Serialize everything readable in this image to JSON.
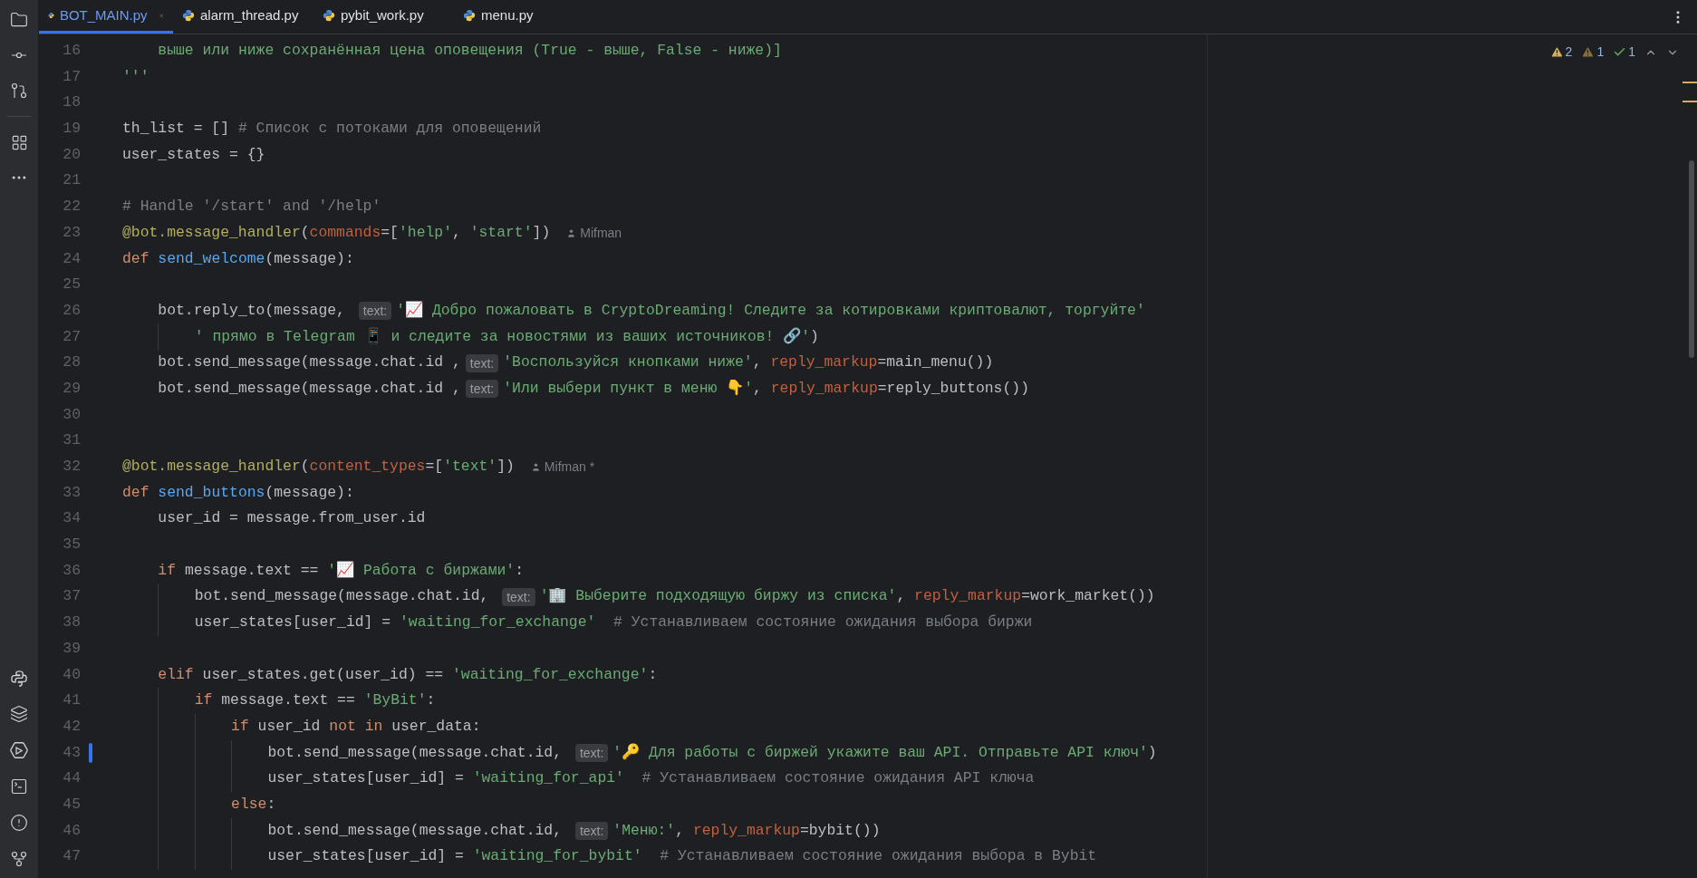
{
  "tabs": [
    {
      "label": "BOT_MAIN.py",
      "selected": true,
      "closable": true
    },
    {
      "label": "alarm_thread.py",
      "selected": false,
      "closable": false
    },
    {
      "label": "pybit_work.py",
      "selected": false,
      "closable": false
    },
    {
      "label": "menu.py",
      "selected": false,
      "closable": false
    }
  ],
  "inspections": [
    {
      "kind": "warning",
      "count": "2"
    },
    {
      "kind": "weak_warning",
      "count": "1"
    },
    {
      "kind": "typo",
      "count": "1"
    }
  ],
  "lines": [
    {
      "number": "16",
      "tokens": [
        {
          "kind": "string",
          "text": "    выше или ниже сохранённая цена оповещения (True - выше, False - ниже)]"
        }
      ]
    },
    {
      "number": "17",
      "tokens": [
        {
          "kind": "string",
          "text": "'''"
        }
      ]
    },
    {
      "number": "18"
    },
    {
      "number": "19",
      "tokens": [
        {
          "kind": "plain",
          "text": "th_list = [] "
        },
        {
          "kind": "comment",
          "text": "# Список с потоками для оповещений"
        }
      ]
    },
    {
      "number": "20",
      "tokens": [
        {
          "kind": "plain",
          "text": "user_states = {}"
        }
      ]
    },
    {
      "number": "21"
    },
    {
      "number": "22",
      "tokens": [
        {
          "kind": "comment",
          "text": "# Handle '/start' and '/help'"
        }
      ]
    },
    {
      "number": "23",
      "tokens": [
        {
          "kind": "decorator",
          "text": "@bot.message_handler"
        },
        {
          "kind": "plain",
          "text": "("
        },
        {
          "kind": "param",
          "text": "commands"
        },
        {
          "kind": "plain",
          "text": "=["
        },
        {
          "kind": "string",
          "text": "'help'"
        },
        {
          "kind": "plain",
          "text": ", "
        },
        {
          "kind": "string",
          "text": "'start'"
        },
        {
          "kind": "plain",
          "text": "])"
        },
        {
          "kind": "author",
          "text": "Mifman"
        }
      ]
    },
    {
      "number": "24",
      "tokens": [
        {
          "kind": "keyword",
          "text": "def "
        },
        {
          "kind": "function",
          "text": "send_welcome"
        },
        {
          "kind": "plain",
          "text": "(message):"
        }
      ]
    },
    {
      "number": "25"
    },
    {
      "number": "26",
      "tokens": [
        {
          "kind": "plain",
          "text": "    bot.reply_to(message, "
        },
        {
          "kind": "hint",
          "text": "text:"
        },
        {
          "kind": "string",
          "text": "'📈 Добро пожаловать в CryptoDreaming! Следите за котировками криптовалют, торгуйте'"
        }
      ]
    },
    {
      "number": "27",
      "tokens": [
        {
          "kind": "string",
          "text": "                                   ' прямо в Telegram 📱 и следите за новостями из ваших источников! 🔗'"
        },
        {
          "kind": "plain",
          "text": ")"
        }
      ]
    },
    {
      "number": "28",
      "tokens": [
        {
          "kind": "plain",
          "text": "    bot.send_message(message.chat.id ,"
        },
        {
          "kind": "hint",
          "text": "text:"
        },
        {
          "kind": "string",
          "text": "'Воспользуйся кнопками ниже'"
        },
        {
          "kind": "plain",
          "text": ", "
        },
        {
          "kind": "param",
          "text": "reply_markup"
        },
        {
          "kind": "plain",
          "text": "=main_menu())"
        }
      ]
    },
    {
      "number": "29",
      "tokens": [
        {
          "kind": "plain",
          "text": "    bot.send_message(message.chat.id ,"
        },
        {
          "kind": "hint",
          "text": "text:"
        },
        {
          "kind": "string",
          "text": "'Или выбери пункт в меню 👇'"
        },
        {
          "kind": "plain",
          "text": ", "
        },
        {
          "kind": "param",
          "text": "reply_markup"
        },
        {
          "kind": "plain",
          "text": "=reply_buttons())"
        }
      ]
    },
    {
      "number": "30"
    },
    {
      "number": "31"
    },
    {
      "number": "32",
      "tokens": [
        {
          "kind": "decorator",
          "text": "@bot.message_handler"
        },
        {
          "kind": "plain",
          "text": "("
        },
        {
          "kind": "param",
          "text": "content_types"
        },
        {
          "kind": "plain",
          "text": "=["
        },
        {
          "kind": "string",
          "text": "'text'"
        },
        {
          "kind": "plain",
          "text": "])"
        },
        {
          "kind": "author",
          "text": "Mifman *"
        }
      ]
    },
    {
      "number": "33",
      "tokens": [
        {
          "kind": "keyword",
          "text": "def "
        },
        {
          "kind": "function",
          "text": "send_buttons"
        },
        {
          "kind": "plain",
          "text": "(message):"
        }
      ]
    },
    {
      "number": "34",
      "tokens": [
        {
          "kind": "plain",
          "text": "    user_id = message.from_user.id"
        }
      ]
    },
    {
      "number": "35"
    },
    {
      "number": "36",
      "tokens": [
        {
          "kind": "keyword",
          "text": "    if "
        },
        {
          "kind": "plain",
          "text": "message.text == "
        },
        {
          "kind": "string",
          "text": "'📈 Работа с биржами'"
        },
        {
          "kind": "plain",
          "text": ":"
        }
      ]
    },
    {
      "number": "37",
      "tokens": [
        {
          "kind": "plain",
          "text": "        bot.send_message(message.chat.id, "
        },
        {
          "kind": "hint",
          "text": "text:"
        },
        {
          "kind": "string",
          "text": "'🏢 Выберите подходящую биржу из списка'"
        },
        {
          "kind": "plain",
          "text": ", "
        },
        {
          "kind": "param",
          "text": "reply_markup"
        },
        {
          "kind": "plain",
          "text": "=work_market())"
        }
      ]
    },
    {
      "number": "38",
      "tokens": [
        {
          "kind": "plain",
          "text": "        user_states[user_id] = "
        },
        {
          "kind": "string",
          "text": "'waiting_for_exchange'"
        },
        {
          "kind": "comment",
          "text": "  # Устанавливаем состояние ожидания выбора биржи"
        }
      ]
    },
    {
      "number": "39"
    },
    {
      "number": "40",
      "tokens": [
        {
          "kind": "keyword",
          "text": "    elif "
        },
        {
          "kind": "plain",
          "text": "user_states.get(user_id) == "
        },
        {
          "kind": "string",
          "text": "'waiting_for_exchange'"
        },
        {
          "kind": "plain",
          "text": ":"
        }
      ]
    },
    {
      "number": "41",
      "tokens": [
        {
          "kind": "keyword",
          "text": "        if "
        },
        {
          "kind": "plain",
          "text": "message.text == "
        },
        {
          "kind": "string",
          "text": "'ByBit'"
        },
        {
          "kind": "plain",
          "text": ":"
        }
      ]
    },
    {
      "number": "42",
      "tokens": [
        {
          "kind": "keyword",
          "text": "            if "
        },
        {
          "kind": "plain",
          "text": "user_id "
        },
        {
          "kind": "keyword",
          "text": "not in "
        },
        {
          "kind": "plain",
          "text": "user_data:"
        }
      ]
    },
    {
      "number": "43",
      "modified": true,
      "tokens": [
        {
          "kind": "plain",
          "text": "                bot.send_message(message.chat.id, "
        },
        {
          "kind": "hint",
          "text": "text:"
        },
        {
          "kind": "string",
          "text": "'🔑 Для работы с биржей укажите ваш API. Отправьте API ключ'"
        },
        {
          "kind": "plain",
          "text": ")"
        }
      ]
    },
    {
      "number": "44",
      "tokens": [
        {
          "kind": "plain",
          "text": "                user_states[user_id] = "
        },
        {
          "kind": "string",
          "text": "'waiting_for_api'"
        },
        {
          "kind": "comment",
          "text": "  # Устанавливаем состояние ожидания API ключа"
        }
      ]
    },
    {
      "number": "45",
      "tokens": [
        {
          "kind": "keyword",
          "text": "            else"
        },
        {
          "kind": "plain",
          "text": ":"
        }
      ]
    },
    {
      "number": "46",
      "tokens": [
        {
          "kind": "plain",
          "text": "                bot.send_message(message.chat.id, "
        },
        {
          "kind": "hint",
          "text": "text:"
        },
        {
          "kind": "string",
          "text": "'Меню:'"
        },
        {
          "kind": "plain",
          "text": ", "
        },
        {
          "kind": "param",
          "text": "reply_markup"
        },
        {
          "kind": "plain",
          "text": "=bybit())"
        }
      ]
    },
    {
      "number": "47",
      "tokens": [
        {
          "kind": "plain",
          "text": "                user_states[user_id] = "
        },
        {
          "kind": "string",
          "text": "'waiting_for_bybit'"
        },
        {
          "kind": "comment",
          "text": "  # Устанавливаем состояние ожидания выбора в Bybit"
        }
      ]
    }
  ]
}
